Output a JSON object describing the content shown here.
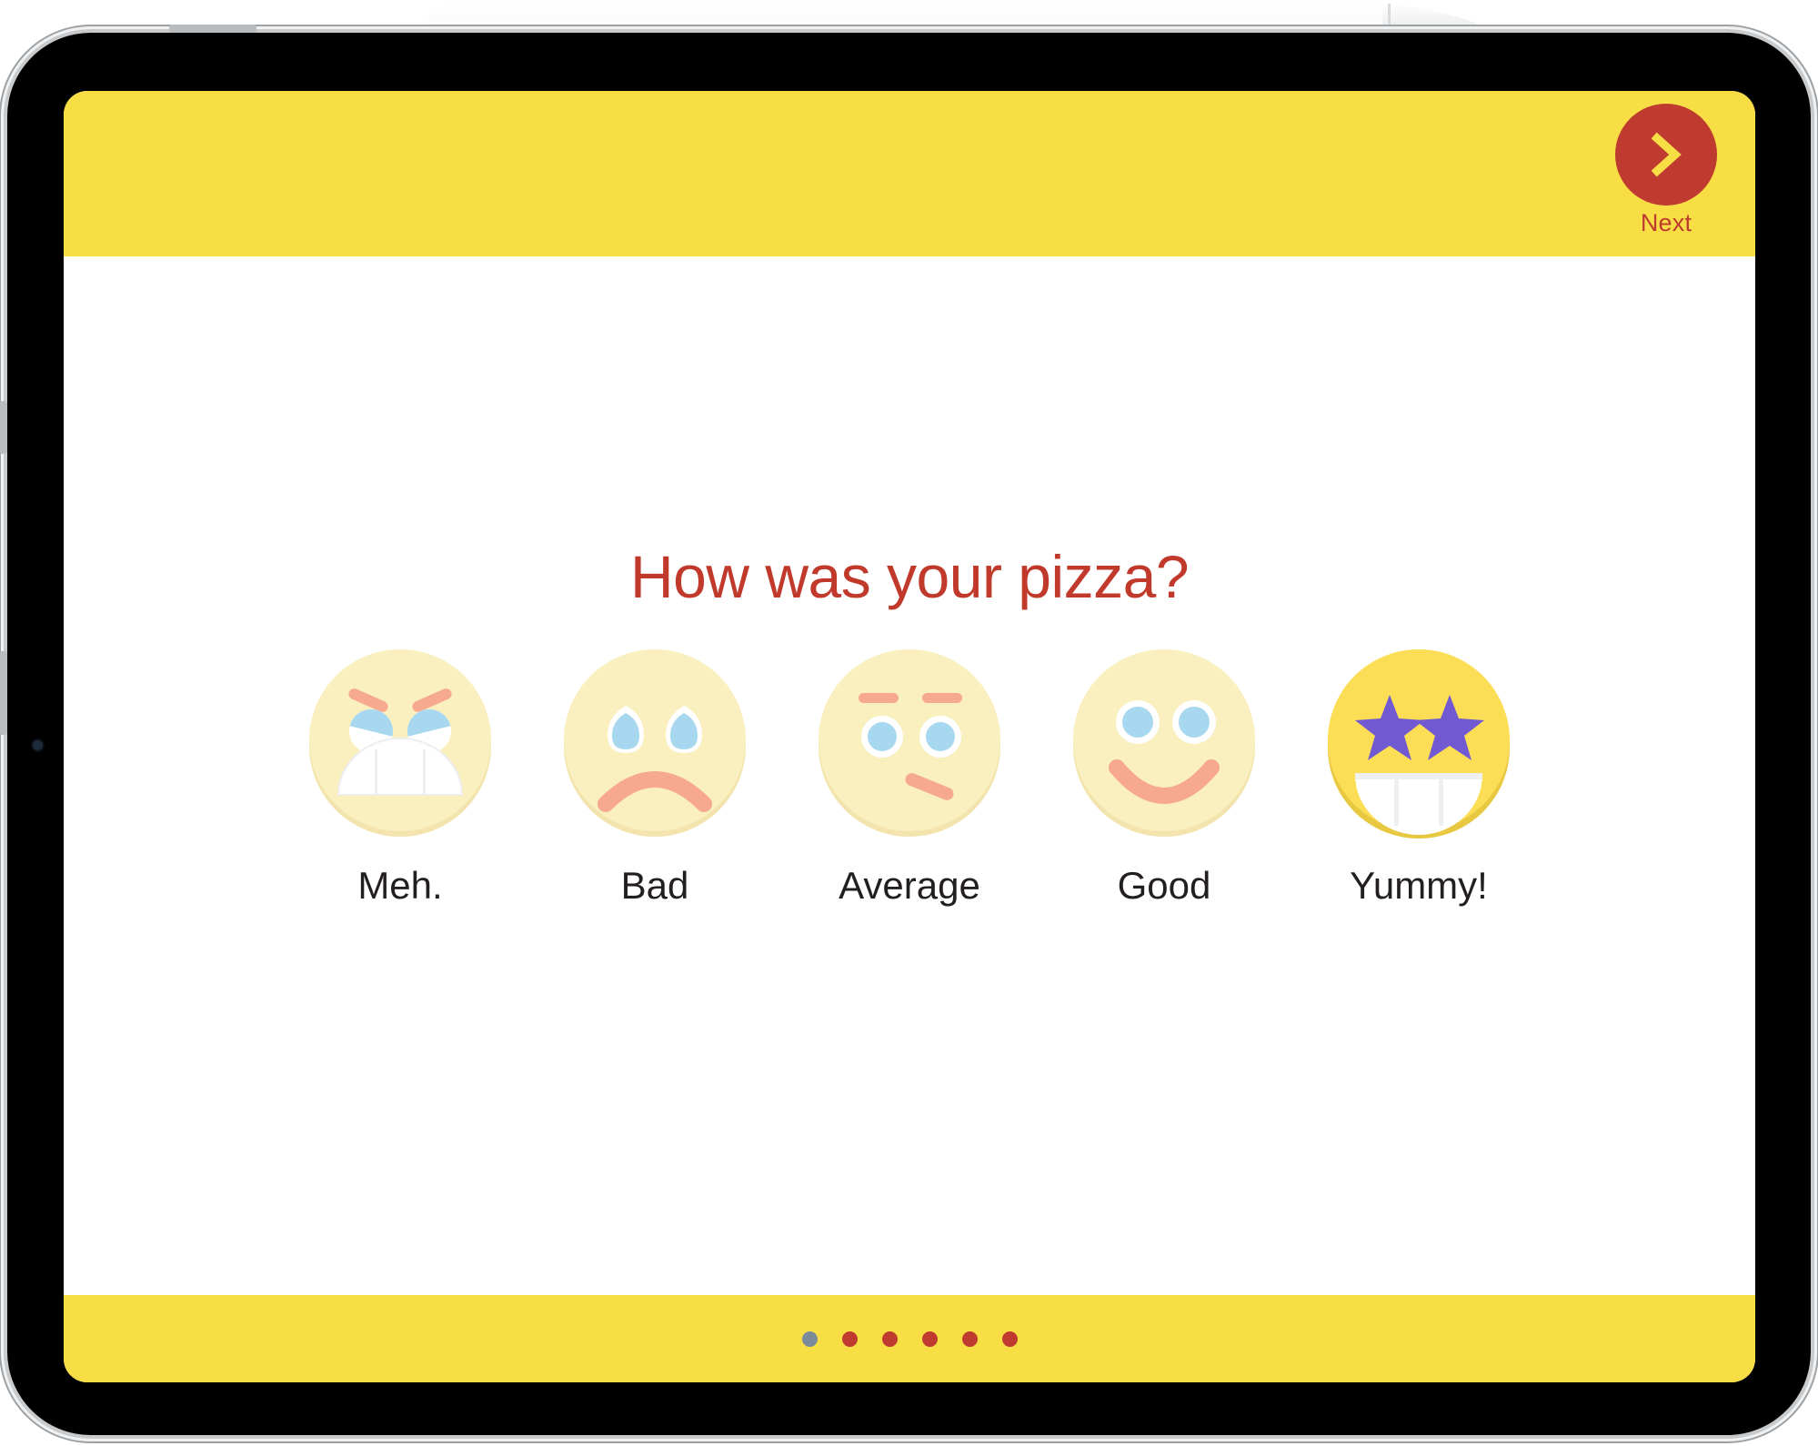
{
  "device": {
    "type": "tablet",
    "accessory": "apple-pencil"
  },
  "header": {
    "background_color": "#F7DE45",
    "next": {
      "label": "Next",
      "icon": "chevron-right-icon",
      "circle_color": "#BF3B2F",
      "label_color": "#BF3B2F"
    }
  },
  "main": {
    "question": "How was your pizza?",
    "question_color": "#C0392B",
    "options": [
      {
        "label": "Meh.",
        "icon": "angry-face-icon",
        "face_color": "#FAEFBE",
        "face_shadow_color": "#F2E4AC",
        "eye_color": "#A8D8EF",
        "brow_color": "#F6A98F",
        "mouth_color": "#FFFFFF"
      },
      {
        "label": "Bad",
        "icon": "sad-face-icon",
        "face_color": "#FAEFBE",
        "face_shadow_color": "#F2E4AC",
        "eye_color": "#A8D8EF",
        "brow_color": "#F6A98F",
        "mouth_color": "#F6A98F"
      },
      {
        "label": "Average",
        "icon": "neutral-face-icon",
        "face_color": "#FAEFBE",
        "face_shadow_color": "#F2E4AC",
        "eye_color": "#A8D8EF",
        "brow_color": "#F6A98F",
        "mouth_color": "#F6A98F"
      },
      {
        "label": "Good",
        "icon": "smiling-face-icon",
        "face_color": "#FAEFBE",
        "face_shadow_color": "#F2E4AC",
        "eye_color": "#A8D8EF",
        "brow_color": "#F6A98F",
        "mouth_color": "#F6A98F"
      },
      {
        "label": "Yummy!",
        "icon": "star-struck-face-icon",
        "face_color": "#FBDE56",
        "face_shadow_color": "#E8C840",
        "eye_color": "#7159D1",
        "brow_color": "#7159D1",
        "mouth_color": "#FFFFFF"
      }
    ]
  },
  "footer": {
    "background_color": "#F7DE45",
    "pagination": {
      "total": 6,
      "active_index": 0,
      "active_color": "#7B8B9A",
      "inactive_color": "#BF3B2F"
    }
  }
}
